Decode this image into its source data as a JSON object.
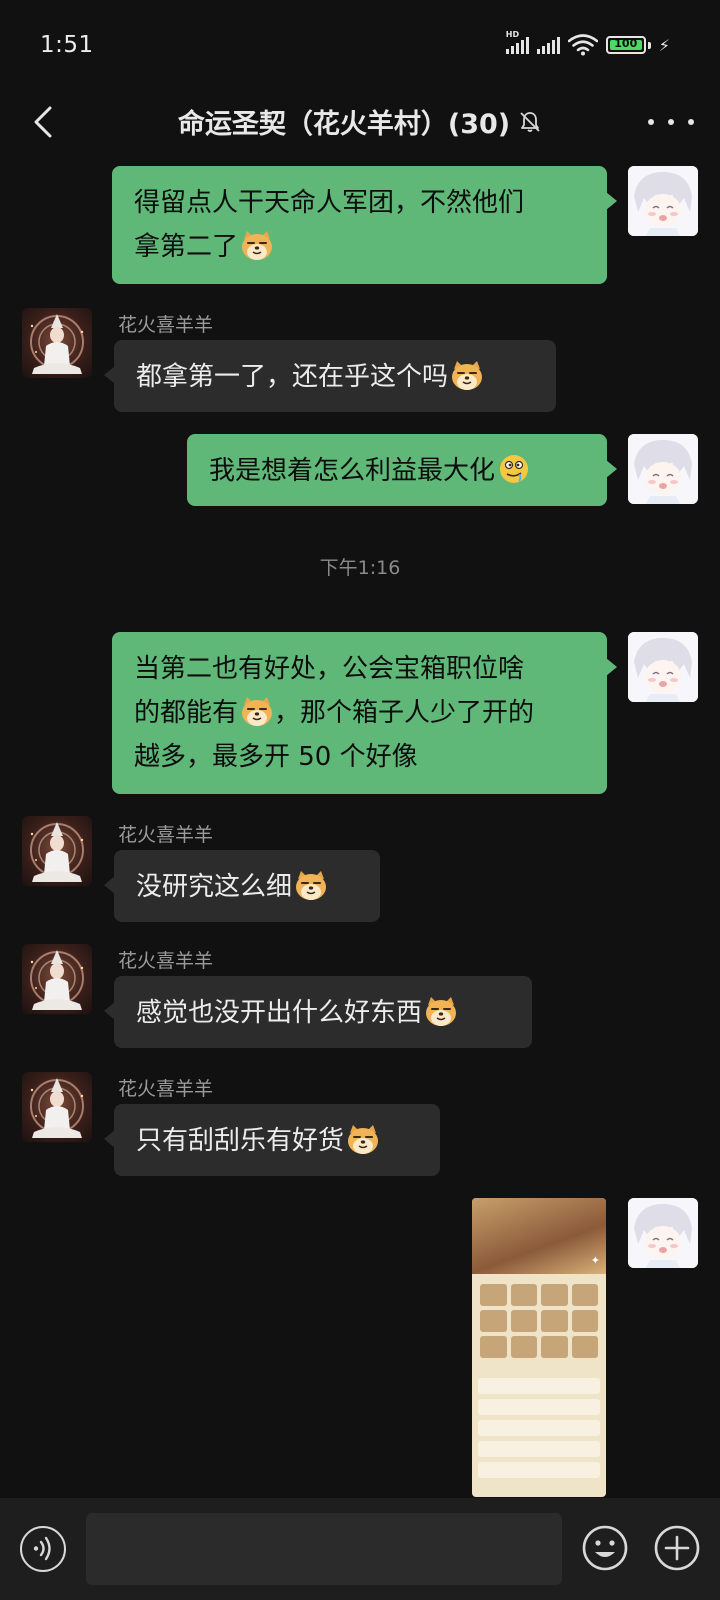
{
  "status_bar": {
    "time": "1:51",
    "network_badge": "HD",
    "battery_level": "100"
  },
  "header": {
    "title": "命运圣契（花火羊村）(30)",
    "muted_icon": "bell-off-icon"
  },
  "time_separator": "下午1:16",
  "messages": [
    {
      "side": "me",
      "lines": [
        "得留点人干天命人军团，不然他们",
        "拿第二了"
      ],
      "emoji": "doge"
    },
    {
      "side": "other",
      "sender": "花火喜羊羊",
      "text": "都拿第一了，还在乎这个吗",
      "emoji": "doge"
    },
    {
      "side": "me",
      "text": "我是想着怎么利益最大化",
      "emoji": "drool-face"
    },
    {
      "side": "me",
      "lines": [
        "当第二也有好处，公会宝箱职位啥",
        "的都能有",
        "越多，最多开 50 个好像"
      ],
      "line2_suffix": "，那个箱子人少了开的",
      "emoji": "doge"
    },
    {
      "side": "other",
      "sender": "花火喜羊羊",
      "text": "没研究这么细",
      "emoji": "doge"
    },
    {
      "side": "other",
      "sender": "花火喜羊羊",
      "text": "感觉也没开出什么好东西",
      "emoji": "doge"
    },
    {
      "side": "other",
      "sender": "花火喜羊羊",
      "text": "只有刮刮乐有好货",
      "emoji": "doge"
    },
    {
      "side": "me",
      "type": "image",
      "image_desc": "game-screenshot-thumbnail"
    }
  ],
  "input": {
    "placeholder": ""
  },
  "colors": {
    "background": "#111111",
    "my_bubble": "#5fb878",
    "other_bubble": "#2c2c2c",
    "input_bar": "#1e1e1e"
  }
}
